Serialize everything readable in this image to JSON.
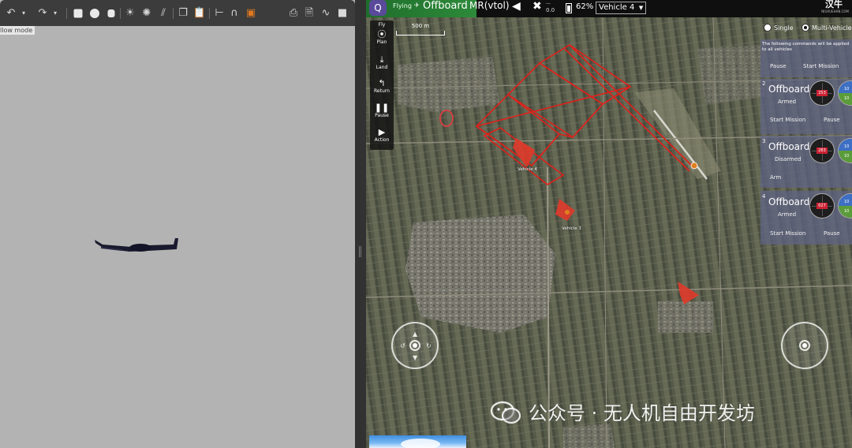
{
  "gazebo": {
    "mode_label": "llow mode"
  },
  "divider": {},
  "qgc": {
    "topbar": {
      "flight_state": "Flying",
      "flight_mode": "Offboard",
      "vehicle_type": "MR(vtol)",
      "gps_count": "0.0",
      "battery": "62%",
      "vehicle_selector": "Vehicle 4",
      "brand": "汉牛",
      "brand_sub": "NIUXUEHAN.COM"
    },
    "fly_tools": [
      {
        "label": "Fly",
        "icon": "fly-icon"
      },
      {
        "label": "Plan",
        "icon": "plan-icon"
      },
      {
        "label": "Land",
        "icon": "land-icon"
      },
      {
        "label": "Return",
        "icon": "return-icon"
      },
      {
        "label": "Pause",
        "icon": "pause-icon"
      },
      {
        "label": "Action",
        "icon": "play-icon"
      }
    ],
    "scale": "500 m",
    "map_labels": {
      "vehicle_a": "Vehicle 4",
      "vehicle_b": "Vehicle 3"
    },
    "multi_vehicle": {
      "single_label": "Single",
      "multi_label": "Multi-Vehicle",
      "selected": "Multi-Vehicle",
      "notice": "The following commands will be applied to all vehicles",
      "pause_all": "Pause",
      "start_mission_all": "Start Mission",
      "vehicles": [
        {
          "id": "2",
          "mode": "Offboard",
          "armed": "Armed",
          "heading": "253",
          "att_top": "10",
          "att_bottom": "10",
          "action_left": "Start Mission",
          "action_right": "Pause"
        },
        {
          "id": "3",
          "mode": "Offboard",
          "armed": "Disarmed",
          "heading": "283",
          "att_top": "10",
          "att_bottom": "10",
          "action_left": "Arm",
          "action_right": ""
        },
        {
          "id": "4",
          "mode": "Offboard",
          "armed": "Armed",
          "heading": "027",
          "att_top": "10",
          "att_bottom": "10",
          "action_left": "Start Mission",
          "action_right": "Pause"
        }
      ]
    }
  },
  "watermark": {
    "text": "公众号 · 无人机自由开发坊"
  },
  "colors": {
    "route": "#e0201a",
    "status_green": "#2d8a3a",
    "panel": "#5f6487"
  }
}
